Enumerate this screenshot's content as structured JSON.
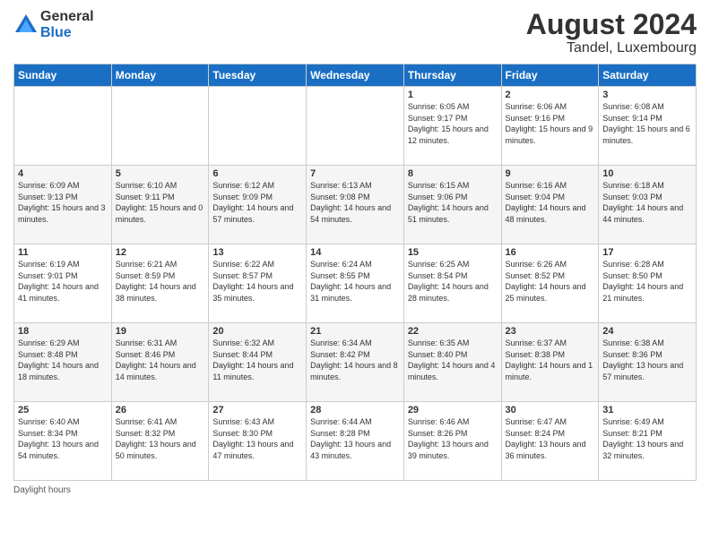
{
  "header": {
    "logo_general": "General",
    "logo_blue": "Blue",
    "month_year": "August 2024",
    "location": "Tandel, Luxembourg"
  },
  "days_of_week": [
    "Sunday",
    "Monday",
    "Tuesday",
    "Wednesday",
    "Thursday",
    "Friday",
    "Saturday"
  ],
  "footer_label": "Daylight hours",
  "weeks": [
    [
      {
        "num": "",
        "sunrise": "",
        "sunset": "",
        "daylight": ""
      },
      {
        "num": "",
        "sunrise": "",
        "sunset": "",
        "daylight": ""
      },
      {
        "num": "",
        "sunrise": "",
        "sunset": "",
        "daylight": ""
      },
      {
        "num": "",
        "sunrise": "",
        "sunset": "",
        "daylight": ""
      },
      {
        "num": "1",
        "sunrise": "Sunrise: 6:05 AM",
        "sunset": "Sunset: 9:17 PM",
        "daylight": "Daylight: 15 hours and 12 minutes."
      },
      {
        "num": "2",
        "sunrise": "Sunrise: 6:06 AM",
        "sunset": "Sunset: 9:16 PM",
        "daylight": "Daylight: 15 hours and 9 minutes."
      },
      {
        "num": "3",
        "sunrise": "Sunrise: 6:08 AM",
        "sunset": "Sunset: 9:14 PM",
        "daylight": "Daylight: 15 hours and 6 minutes."
      }
    ],
    [
      {
        "num": "4",
        "sunrise": "Sunrise: 6:09 AM",
        "sunset": "Sunset: 9:13 PM",
        "daylight": "Daylight: 15 hours and 3 minutes."
      },
      {
        "num": "5",
        "sunrise": "Sunrise: 6:10 AM",
        "sunset": "Sunset: 9:11 PM",
        "daylight": "Daylight: 15 hours and 0 minutes."
      },
      {
        "num": "6",
        "sunrise": "Sunrise: 6:12 AM",
        "sunset": "Sunset: 9:09 PM",
        "daylight": "Daylight: 14 hours and 57 minutes."
      },
      {
        "num": "7",
        "sunrise": "Sunrise: 6:13 AM",
        "sunset": "Sunset: 9:08 PM",
        "daylight": "Daylight: 14 hours and 54 minutes."
      },
      {
        "num": "8",
        "sunrise": "Sunrise: 6:15 AM",
        "sunset": "Sunset: 9:06 PM",
        "daylight": "Daylight: 14 hours and 51 minutes."
      },
      {
        "num": "9",
        "sunrise": "Sunrise: 6:16 AM",
        "sunset": "Sunset: 9:04 PM",
        "daylight": "Daylight: 14 hours and 48 minutes."
      },
      {
        "num": "10",
        "sunrise": "Sunrise: 6:18 AM",
        "sunset": "Sunset: 9:03 PM",
        "daylight": "Daylight: 14 hours and 44 minutes."
      }
    ],
    [
      {
        "num": "11",
        "sunrise": "Sunrise: 6:19 AM",
        "sunset": "Sunset: 9:01 PM",
        "daylight": "Daylight: 14 hours and 41 minutes."
      },
      {
        "num": "12",
        "sunrise": "Sunrise: 6:21 AM",
        "sunset": "Sunset: 8:59 PM",
        "daylight": "Daylight: 14 hours and 38 minutes."
      },
      {
        "num": "13",
        "sunrise": "Sunrise: 6:22 AM",
        "sunset": "Sunset: 8:57 PM",
        "daylight": "Daylight: 14 hours and 35 minutes."
      },
      {
        "num": "14",
        "sunrise": "Sunrise: 6:24 AM",
        "sunset": "Sunset: 8:55 PM",
        "daylight": "Daylight: 14 hours and 31 minutes."
      },
      {
        "num": "15",
        "sunrise": "Sunrise: 6:25 AM",
        "sunset": "Sunset: 8:54 PM",
        "daylight": "Daylight: 14 hours and 28 minutes."
      },
      {
        "num": "16",
        "sunrise": "Sunrise: 6:26 AM",
        "sunset": "Sunset: 8:52 PM",
        "daylight": "Daylight: 14 hours and 25 minutes."
      },
      {
        "num": "17",
        "sunrise": "Sunrise: 6:28 AM",
        "sunset": "Sunset: 8:50 PM",
        "daylight": "Daylight: 14 hours and 21 minutes."
      }
    ],
    [
      {
        "num": "18",
        "sunrise": "Sunrise: 6:29 AM",
        "sunset": "Sunset: 8:48 PM",
        "daylight": "Daylight: 14 hours and 18 minutes."
      },
      {
        "num": "19",
        "sunrise": "Sunrise: 6:31 AM",
        "sunset": "Sunset: 8:46 PM",
        "daylight": "Daylight: 14 hours and 14 minutes."
      },
      {
        "num": "20",
        "sunrise": "Sunrise: 6:32 AM",
        "sunset": "Sunset: 8:44 PM",
        "daylight": "Daylight: 14 hours and 11 minutes."
      },
      {
        "num": "21",
        "sunrise": "Sunrise: 6:34 AM",
        "sunset": "Sunset: 8:42 PM",
        "daylight": "Daylight: 14 hours and 8 minutes."
      },
      {
        "num": "22",
        "sunrise": "Sunrise: 6:35 AM",
        "sunset": "Sunset: 8:40 PM",
        "daylight": "Daylight: 14 hours and 4 minutes."
      },
      {
        "num": "23",
        "sunrise": "Sunrise: 6:37 AM",
        "sunset": "Sunset: 8:38 PM",
        "daylight": "Daylight: 14 hours and 1 minute."
      },
      {
        "num": "24",
        "sunrise": "Sunrise: 6:38 AM",
        "sunset": "Sunset: 8:36 PM",
        "daylight": "Daylight: 13 hours and 57 minutes."
      }
    ],
    [
      {
        "num": "25",
        "sunrise": "Sunrise: 6:40 AM",
        "sunset": "Sunset: 8:34 PM",
        "daylight": "Daylight: 13 hours and 54 minutes."
      },
      {
        "num": "26",
        "sunrise": "Sunrise: 6:41 AM",
        "sunset": "Sunset: 8:32 PM",
        "daylight": "Daylight: 13 hours and 50 minutes."
      },
      {
        "num": "27",
        "sunrise": "Sunrise: 6:43 AM",
        "sunset": "Sunset: 8:30 PM",
        "daylight": "Daylight: 13 hours and 47 minutes."
      },
      {
        "num": "28",
        "sunrise": "Sunrise: 6:44 AM",
        "sunset": "Sunset: 8:28 PM",
        "daylight": "Daylight: 13 hours and 43 minutes."
      },
      {
        "num": "29",
        "sunrise": "Sunrise: 6:46 AM",
        "sunset": "Sunset: 8:26 PM",
        "daylight": "Daylight: 13 hours and 39 minutes."
      },
      {
        "num": "30",
        "sunrise": "Sunrise: 6:47 AM",
        "sunset": "Sunset: 8:24 PM",
        "daylight": "Daylight: 13 hours and 36 minutes."
      },
      {
        "num": "31",
        "sunrise": "Sunrise: 6:49 AM",
        "sunset": "Sunset: 8:21 PM",
        "daylight": "Daylight: 13 hours and 32 minutes."
      }
    ]
  ]
}
